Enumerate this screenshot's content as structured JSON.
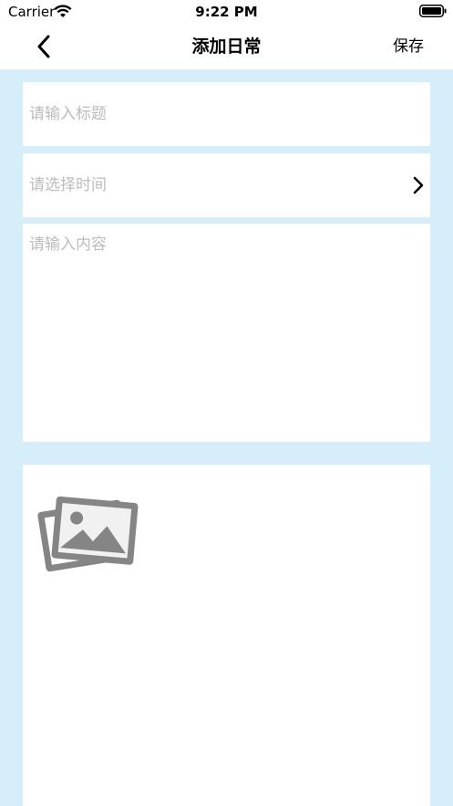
{
  "status_bar": {
    "carrier": "Carrier",
    "time": "9:22 PM",
    "icons": [
      "wifi-icon",
      "battery-icon"
    ]
  },
  "nav": {
    "back_icon": "chevron-left-icon",
    "title": "添加日常",
    "save_label": "保存"
  },
  "form": {
    "title_placeholder": "请输入标题",
    "time_placeholder": "请选择时间",
    "time_chevron_icon": "chevron-right-icon",
    "content_placeholder": "请输入内容",
    "image_picker_icon": "photo-gallery-icon"
  },
  "colors": {
    "background": "#d6eefa",
    "card": "#ffffff",
    "placeholder": "#bcbcbc",
    "icon_gray": "#858585"
  }
}
